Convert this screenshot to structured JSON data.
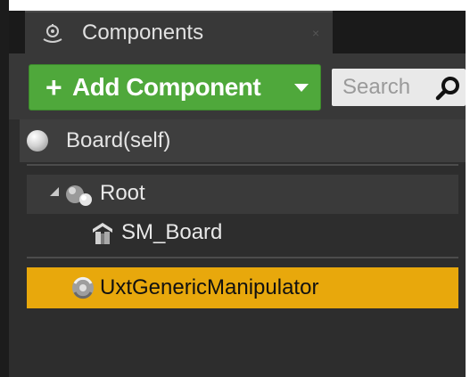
{
  "tab": {
    "title": "Components",
    "close_symbol": "×",
    "icon": "components-icon"
  },
  "toolbar": {
    "add_plus": "+",
    "add_label": "Add Component",
    "add_color": "#4fa83b",
    "search_placeholder": "Search",
    "search_value": ""
  },
  "self_item": {
    "label": "Board(self)",
    "icon": "sphere-icon"
  },
  "tree": {
    "root": {
      "label": "Root",
      "icon": "scene-component-icon",
      "expanded": true
    },
    "children": [
      {
        "label": "SM_Board",
        "icon": "static-mesh-icon"
      }
    ],
    "actor_components": [
      {
        "label": "UxtGenericManipulator",
        "icon": "actor-component-icon",
        "selected": true,
        "highlight_color": "#e8a80c"
      }
    ]
  }
}
